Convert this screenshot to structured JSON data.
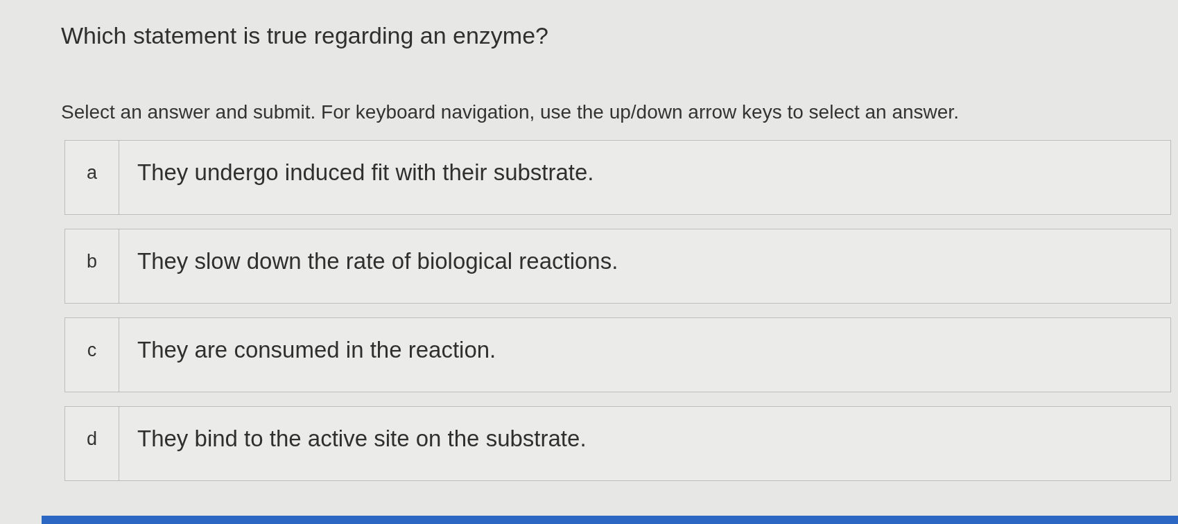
{
  "question": {
    "title": "Which statement is true regarding an enzyme?",
    "instructions": "Select an answer and submit. For keyboard navigation, use the up/down arrow keys to select an answer."
  },
  "options": [
    {
      "letter": "a",
      "text": "They undergo induced fit with their substrate.",
      "selected": false
    },
    {
      "letter": "b",
      "text": "They slow down the rate of biological reactions.",
      "selected": false
    },
    {
      "letter": "c",
      "text": "They are consumed in the reaction.",
      "selected": false
    },
    {
      "letter": "d",
      "text": "They bind to the active site on the substrate.",
      "selected": false
    }
  ]
}
